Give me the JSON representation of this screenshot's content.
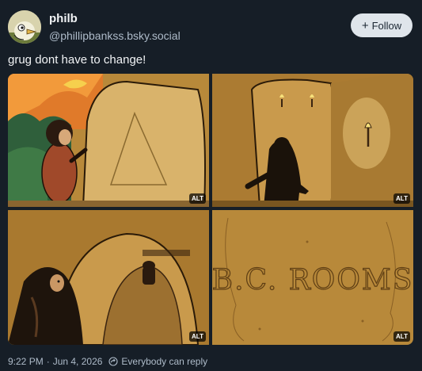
{
  "author": {
    "display_name": "philb",
    "handle": "@phillipbankss.bsky.social",
    "avatar_icon": "avatar-cartoon-bird"
  },
  "follow_button": {
    "label": "Follow",
    "icon": "plus-icon"
  },
  "post": {
    "text": "grug dont have to change!"
  },
  "images": [
    {
      "alt_badge": "ALT",
      "depicts": "caveman-by-rock-wall"
    },
    {
      "alt_badge": "ALT",
      "depicts": "caveman-silhouette-torch-corridor"
    },
    {
      "alt_badge": "ALT",
      "depicts": "caveman-in-cave-tunnel"
    },
    {
      "alt_badge": "ALT",
      "depicts": "carved-wall",
      "carving_text": "B.C. ROOMS"
    }
  ],
  "footer": {
    "time": "9:22 PM",
    "date": "Jun 4, 2026",
    "separator": "·",
    "reply_setting": "Everybody can reply",
    "reply_icon": "globe-reply-icon"
  },
  "colors": {
    "background": "#161e27",
    "follow_bg": "#dfe5eb",
    "muted_text": "#aebbc9",
    "comic_ochre": "#b8893a"
  }
}
